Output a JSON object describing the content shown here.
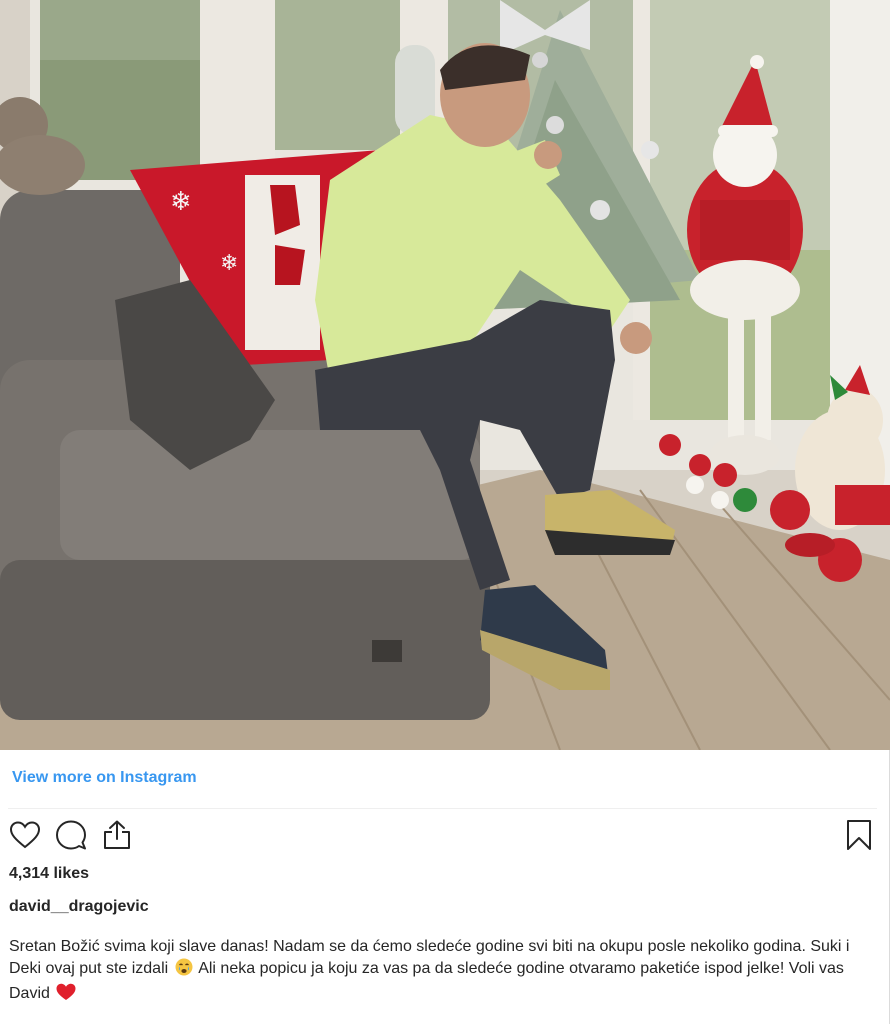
{
  "post": {
    "view_more_label": "View more on Instagram",
    "likes_text": "4,314 likes",
    "username": "david__dragojevic",
    "caption_part1": "Sretan Božić svima koji slave danas! Nadam se da ćemo sledeće godine svi biti na okupu posle nekoliko godina. Suki i Deki ovaj put ste izdali",
    "caption_part2": "Ali neka popicu ja koju za vas pa da sledeće godine otvaramo paketiće ispod jelke! Voli vas David",
    "emoji_1": "crying-face-emoji",
    "emoji_2": "red-heart-emoji"
  },
  "icons": {
    "like": "heart-icon",
    "comment": "comment-icon",
    "share": "share-icon",
    "save": "bookmark-icon"
  },
  "colors": {
    "link": "#3897f0",
    "text": "#262626",
    "divider": "#efefef",
    "heart": "#ed4956"
  }
}
